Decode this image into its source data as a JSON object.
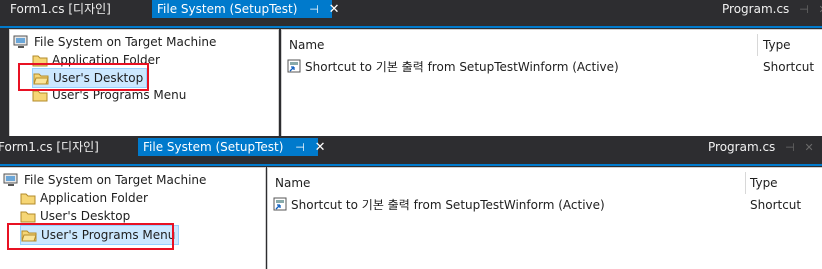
{
  "tabs": {
    "form1": "Form1.cs [디자인]",
    "filesystem": "File System (SetupTest)",
    "program": "Program.cs"
  },
  "tree": {
    "root": "File System on Target Machine",
    "app_folder": "Application Folder",
    "desktop": "User's Desktop",
    "programs_menu": "User's Programs Menu"
  },
  "list": {
    "col_name": "Name",
    "col_type": "Type",
    "row_name": "Shortcut to 기본 출력 from SetupTestWinform (Active)",
    "row_type": "Shortcut"
  },
  "state": {
    "top_selected": "User's Desktop",
    "bottom_selected": "User's Programs Menu"
  },
  "colors": {
    "accent": "#007acc",
    "highlight_box": "#e81123",
    "selection": "#cce8ff"
  }
}
